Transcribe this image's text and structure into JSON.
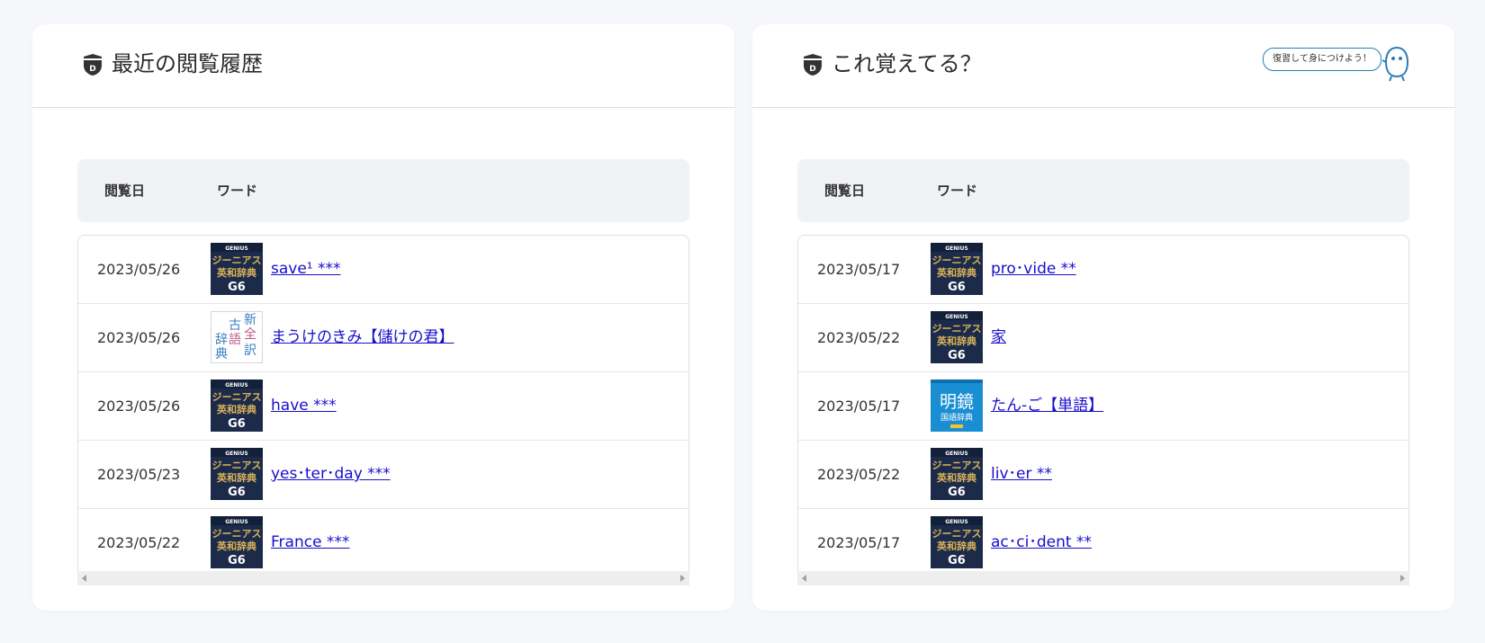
{
  "left_panel": {
    "title": "最近の閲覧履歴",
    "table": {
      "headers": {
        "date": "閲覧日",
        "word": "ワード"
      },
      "rows": [
        {
          "date": "2023/05/26",
          "dict": "genius",
          "word": "save¹ ***"
        },
        {
          "date": "2023/05/26",
          "dict": "kogo",
          "word": "まうけのきみ【儲けの君】"
        },
        {
          "date": "2023/05/26",
          "dict": "genius",
          "word": "have ***"
        },
        {
          "date": "2023/05/23",
          "dict": "genius",
          "word": "yes･ter･day ***"
        },
        {
          "date": "2023/05/22",
          "dict": "genius",
          "word": "France ***"
        }
      ]
    }
  },
  "right_panel": {
    "title": "これ覚えてる？",
    "bubble_text": "復習して身につけよう！",
    "table": {
      "headers": {
        "date": "閲覧日",
        "word": "ワード"
      },
      "rows": [
        {
          "date": "2023/05/17",
          "dict": "genius",
          "word": "pro･vide **"
        },
        {
          "date": "2023/05/22",
          "dict": "genius",
          "word": "家"
        },
        {
          "date": "2023/05/17",
          "dict": "meikyo",
          "word": "たん-ご【単語】"
        },
        {
          "date": "2023/05/22",
          "dict": "genius",
          "word": "liv･er **"
        },
        {
          "date": "2023/05/17",
          "dict": "genius",
          "word": "ac･ci･dent **"
        }
      ]
    }
  },
  "dict_icons": {
    "genius": {
      "top": "GENIUS",
      "line1": "ジーニアス",
      "line2": "英和辞典",
      "line3": "G6"
    },
    "kogo": {
      "chars": [
        "新",
        "古",
        "全",
        "語",
        "訳",
        "辞",
        "典"
      ]
    },
    "meikyo": {
      "line1": "明鏡",
      "line2": "国語辞典"
    }
  },
  "colors": {
    "accent": "#2a7db5",
    "link": "#1a0dcc",
    "header_bg": "#f0f2f5"
  }
}
